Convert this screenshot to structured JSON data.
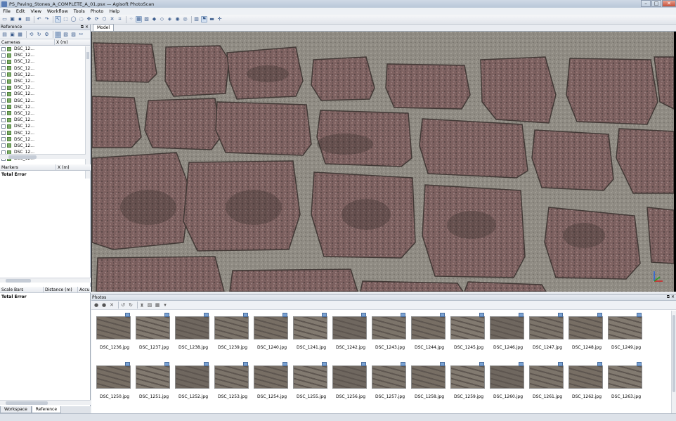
{
  "window": {
    "title": "PS_Paving_Stones_A_COMPLETE_A_01.psx — Agisoft PhotoScan"
  },
  "menu": [
    "File",
    "Edit",
    "View",
    "Workflow",
    "Tools",
    "Photo",
    "Help"
  ],
  "reference": {
    "title": "Reference",
    "cameras_header": {
      "col1": "Cameras",
      "col2": "X (m)"
    },
    "cameras": [
      "DSC_12...",
      "DSC_12...",
      "DSC_12...",
      "DSC_12...",
      "DSC_12...",
      "DSC_12...",
      "DSC_12...",
      "DSC_12...",
      "DSC_12...",
      "DSC_12...",
      "DSC_12...",
      "DSC_12...",
      "DSC_12...",
      "DSC_12...",
      "DSC_12...",
      "DSC_12...",
      "DSC_12...",
      "DSC_12..."
    ],
    "markers_header": {
      "col1": "Markers",
      "col2": "X (m)"
    },
    "markers_total": "Total Error",
    "scalebars_header": {
      "col1": "Scale Bars",
      "col2": "Distance (m)",
      "col3": "Accu"
    },
    "scalebars_total": "Total Error"
  },
  "bottom_tabs": [
    "Workspace",
    "Reference"
  ],
  "model": {
    "tab": "Model"
  },
  "photos": {
    "title": "Photos",
    "row1": [
      "DSC_1236.jpg",
      "DSC_1237.jpg",
      "DSC_1238.jpg",
      "DSC_1239.jpg",
      "DSC_1240.jpg",
      "DSC_1241.jpg",
      "DSC_1242.jpg",
      "DSC_1243.jpg",
      "DSC_1244.jpg",
      "DSC_1245.jpg",
      "DSC_1246.jpg",
      "DSC_1247.jpg",
      "DSC_1248.jpg",
      "DSC_1249.jpg"
    ],
    "row2": [
      "DSC_1250.jpg",
      "DSC_1251.jpg",
      "DSC_1252.jpg",
      "DSC_1253.jpg",
      "DSC_1254.jpg",
      "DSC_1255.jpg",
      "DSC_1256.jpg",
      "DSC_1257.jpg",
      "DSC_1258.jpg",
      "DSC_1259.jpg",
      "DSC_1260.jpg",
      "DSC_1261.jpg",
      "DSC_1262.jpg",
      "DSC_1263.jpg"
    ]
  }
}
